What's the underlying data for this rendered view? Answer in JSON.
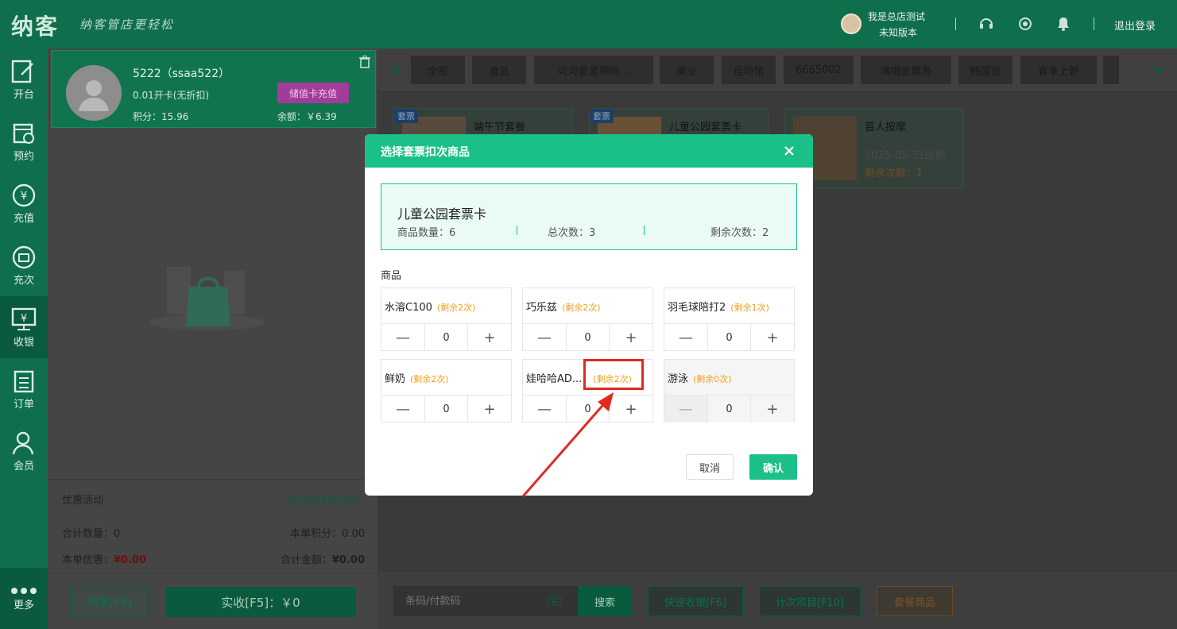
{
  "app": {
    "logo": "纳客",
    "slogan": "纳客管店更轻松",
    "user_name": "我是总店测试",
    "user_version": "未知版本",
    "logout": "退出登录"
  },
  "nav": {
    "items": [
      {
        "label": "开台",
        "icon": "table-edit-icon"
      },
      {
        "label": "预约",
        "icon": "calendar-clock-icon"
      },
      {
        "label": "充值",
        "icon": "yen-circle-icon"
      },
      {
        "label": "充次",
        "icon": "ticket-circle-icon"
      },
      {
        "label": "收银",
        "icon": "cashier-icon"
      },
      {
        "label": "订单",
        "icon": "order-list-icon"
      },
      {
        "label": "会员",
        "icon": "member-icon"
      }
    ],
    "more": "更多"
  },
  "member": {
    "name": "5222（ssaa522）",
    "card_type": "0.01开卡(无折扣)",
    "points": "积分：15.96",
    "balance": "余额：￥6.39",
    "recharge_button": "储值卡充值"
  },
  "summary": {
    "promo_label": "优惠活动",
    "promo_select": "请选择优惠活动 ›",
    "total_qty": "合计数量：0",
    "order_points": "本单积分：0.00",
    "order_discount_label": "本单优惠：",
    "order_discount_value": "¥0.00",
    "order_total_label": "合计金额：",
    "order_total_value": "¥0.00",
    "cancel_order": "取单[F8]",
    "pay": "实收[F5]：￥0"
  },
  "tabs": [
    "全部",
    "食品",
    "可可爱爱啊哈...",
    "美业",
    "运动馆",
    "6665002",
    "演唱会票务",
    "韩国货",
    "春季上新"
  ],
  "packages": [
    {
      "badge": "套票",
      "name": "端午节套餐",
      "expire": "",
      "remain": ""
    },
    {
      "badge": "套票",
      "name": "儿童公园套票卡",
      "expire": "",
      "remain": ""
    },
    {
      "badge": "",
      "name": "盲人按摩",
      "expire": "2025-05-31过期",
      "remain": "剩余次数：1"
    }
  ],
  "bottom": {
    "barcode_placeholder": "条码/付款码",
    "search": "搜索",
    "quick_pay": "快速收银[F6]",
    "count_items": "计次项目[F10]",
    "package_goods": "套餐商品"
  },
  "modal": {
    "title": "选择套票扣次商品",
    "card_name": "儿童公园套票卡",
    "goods_count": "商品数量：6",
    "total_times": "总次数：3",
    "remaining_times": "剩余次数：2",
    "section_label": "商品",
    "items": [
      {
        "name": "水溶C100",
        "remain": "(剩余2次)",
        "qty": "0",
        "disabled": false
      },
      {
        "name": "巧乐兹",
        "remain": "(剩余2次)",
        "qty": "0",
        "disabled": false
      },
      {
        "name": "羽毛球陪打2",
        "remain": "(剩余1次)",
        "qty": "0",
        "disabled": false
      },
      {
        "name": "鲜奶",
        "remain": "(剩余2次)",
        "qty": "0",
        "disabled": false
      },
      {
        "name": "娃哈哈AD...",
        "remain": "(剩余2次)",
        "qty": "0",
        "disabled": false
      },
      {
        "name": "游泳",
        "remain": "(剩余0次)",
        "qty": "0",
        "disabled": true
      }
    ],
    "minus": "—",
    "plus": "+",
    "cancel": "取消",
    "confirm": "确认"
  },
  "colors": {
    "brand_green": "#0f6e4c",
    "modal_green": "#1bc088",
    "remain_orange": "#f0a020",
    "annotation_red": "#e02a20"
  }
}
